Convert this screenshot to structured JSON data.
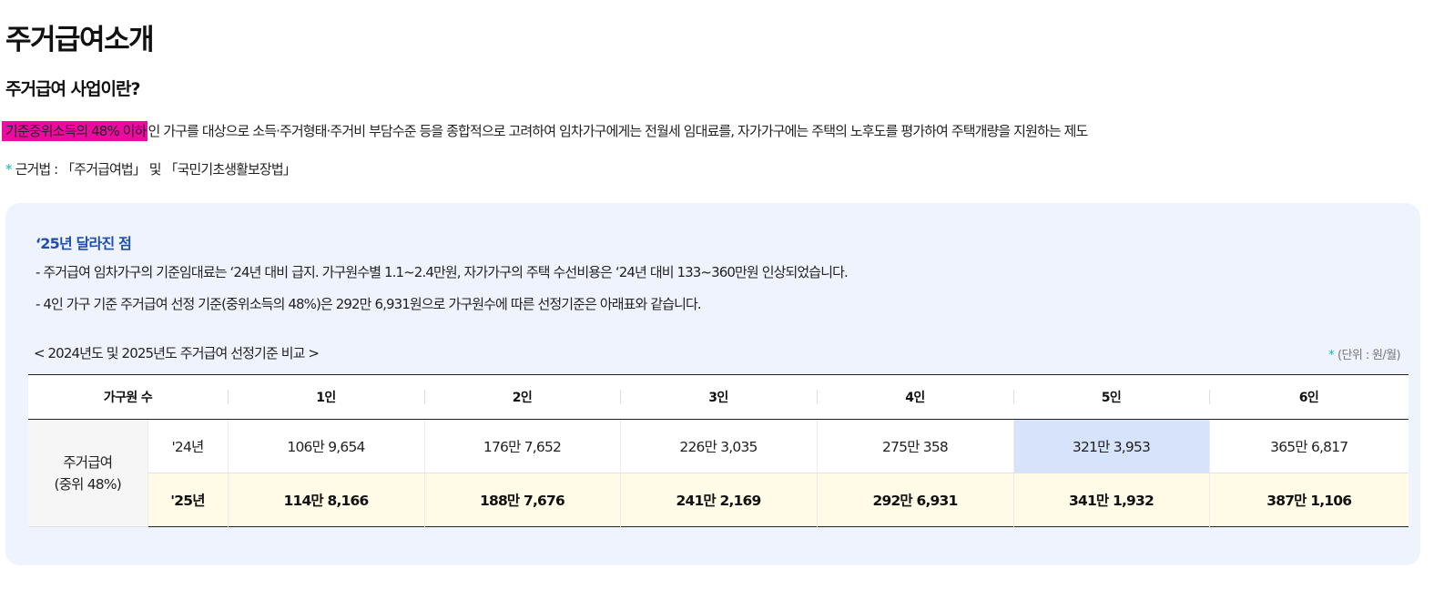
{
  "page_title": "주거급여소개",
  "section_title": "주거급여 사업이란?",
  "intro": {
    "highlight": "기준중위소득의 48% 이하",
    "rest": "인 가구를 대상으로 소득·주거형태·주거비 부담수준 등을 종합적으로 고려하여 임차가구에게는 전월세 임대료를, 자가가구에는 주택의 노후도를 평가하여 주택개량을 지원하는 제도"
  },
  "law": {
    "marker": "*",
    "text": "근거법 : 「주거급여법」 및 「국민기초생활보장법」"
  },
  "changes": {
    "title": "‘25년 달라진 점",
    "items": [
      "-  주거급여 임차가구의 기준임대료는 ‘24년 대비 급지. 가구원수별 1.1~2.4만원, 자가가구의 주택 수선비용은 ‘24년 대비 133~360만원 인상되었습니다.",
      "-  4인 가구 기준 주거급여 선정 기준(중위소득의 48%)은 292만 6,931원으로 가구원수에 따른 선정기준은 아래표와 같습니다."
    ]
  },
  "table": {
    "caption": "< 2024년도 및 2025년도 주거급여 선정기준 비교 >",
    "unit_marker": "*",
    "unit": "(단위 : 원/월)",
    "header_first": "가구원 수",
    "headers": [
      "1인",
      "2인",
      "3인",
      "4인",
      "5인",
      "6인"
    ],
    "row_label_line1": "주거급여",
    "row_label_line2": "(중위 48%)",
    "rows": [
      {
        "year": "'24년",
        "values": [
          "106만 9,654",
          "176만 7,652",
          "226만 3,035",
          "275만 358",
          "321만 3,953",
          "365만 6,817"
        ]
      },
      {
        "year": "'25년",
        "values": [
          "114만 8,166",
          "188만 7,676",
          "241만 2,169",
          "292만 6,931",
          "341만 1,932",
          "387만 1,106"
        ]
      }
    ]
  },
  "colors": {
    "highlight": "#ee0aa0",
    "accent_title": "#1d4fb3",
    "marker": "#13b5b5",
    "box_bg": "#eef3fd",
    "row25_bg": "#fffbe6",
    "selected_cell": "#d6e3fb"
  }
}
